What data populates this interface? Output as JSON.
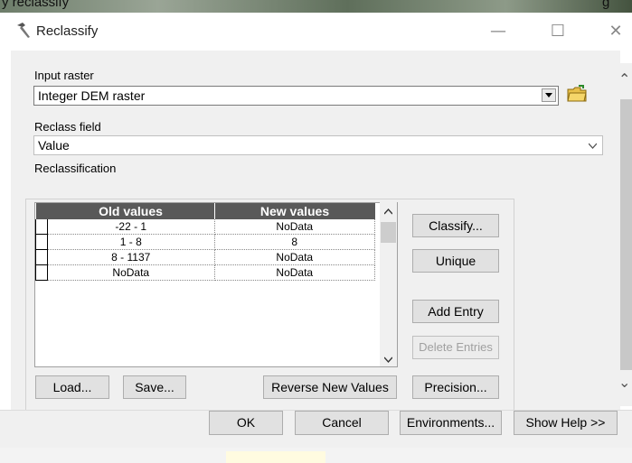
{
  "background": {
    "text_left": "y reclassify",
    "text_right": "g"
  },
  "window": {
    "title": "Reclassify",
    "min_glyph": "—",
    "max_glyph": "☐",
    "close_glyph": "✕",
    "icon": "hammer-icon"
  },
  "input_raster": {
    "label": "Input raster",
    "value": "Integer DEM raster",
    "browse_icon": "folder-open-icon"
  },
  "reclass_field": {
    "label": "Reclass field",
    "value": "Value"
  },
  "reclassification": {
    "label": "Reclassification",
    "columns": [
      "Old values",
      "New values"
    ],
    "rows": [
      {
        "old": "-22 - 1",
        "new": "NoData"
      },
      {
        "old": "1 - 8",
        "new": "8"
      },
      {
        "old": "8 - 1137",
        "new": "NoData"
      },
      {
        "old": "NoData",
        "new": "NoData"
      }
    ],
    "buttons": {
      "classify": "Classify...",
      "unique": "Unique",
      "add_entry": "Add Entry",
      "delete_entries": "Delete Entries",
      "load": "Load...",
      "save": "Save...",
      "reverse": "Reverse New Values",
      "precision": "Precision..."
    }
  },
  "footer": {
    "ok": "OK",
    "cancel": "Cancel",
    "environments": "Environments...",
    "show_help": "Show Help >>"
  },
  "colors": {
    "header_bg": "#595959",
    "dialog_bg": "#f0f0f0",
    "accent": "#0078d7"
  }
}
